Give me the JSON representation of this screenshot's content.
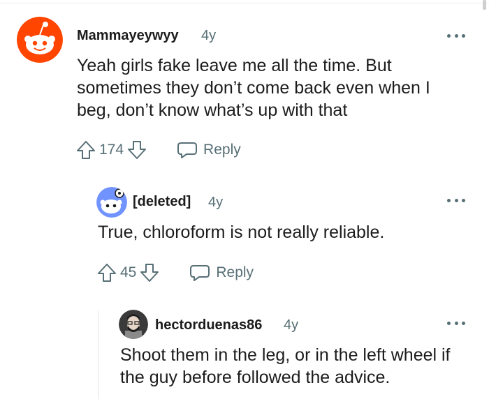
{
  "comments": [
    {
      "author": "Mammayeywyy",
      "age": "4y",
      "text": "Yeah girls fake leave me all the time. But sometimes they don’t come back even when I beg, don’t know what’s up with that",
      "votes": "174",
      "reply_label": "Reply"
    },
    {
      "author": "[deleted]",
      "age": "4y",
      "text": "True, chloroform is not really reliable.",
      "votes": "45",
      "reply_label": "Reply"
    },
    {
      "author": "hectorduenas86",
      "age": "4y",
      "text": "Shoot them in the leg, or in the left wheel if the guy before followed the advice."
    }
  ],
  "colors": {
    "accent": "#ff4500",
    "meta": "#576f76",
    "text": "#1c1c1c",
    "deleted_avatar": "#7193ff"
  },
  "icons": [
    "snoo-avatar-icon",
    "deleted-user-avatar-icon",
    "user-avatar-icon",
    "upvote-icon",
    "downvote-icon",
    "reply-icon",
    "overflow-menu-icon"
  ]
}
